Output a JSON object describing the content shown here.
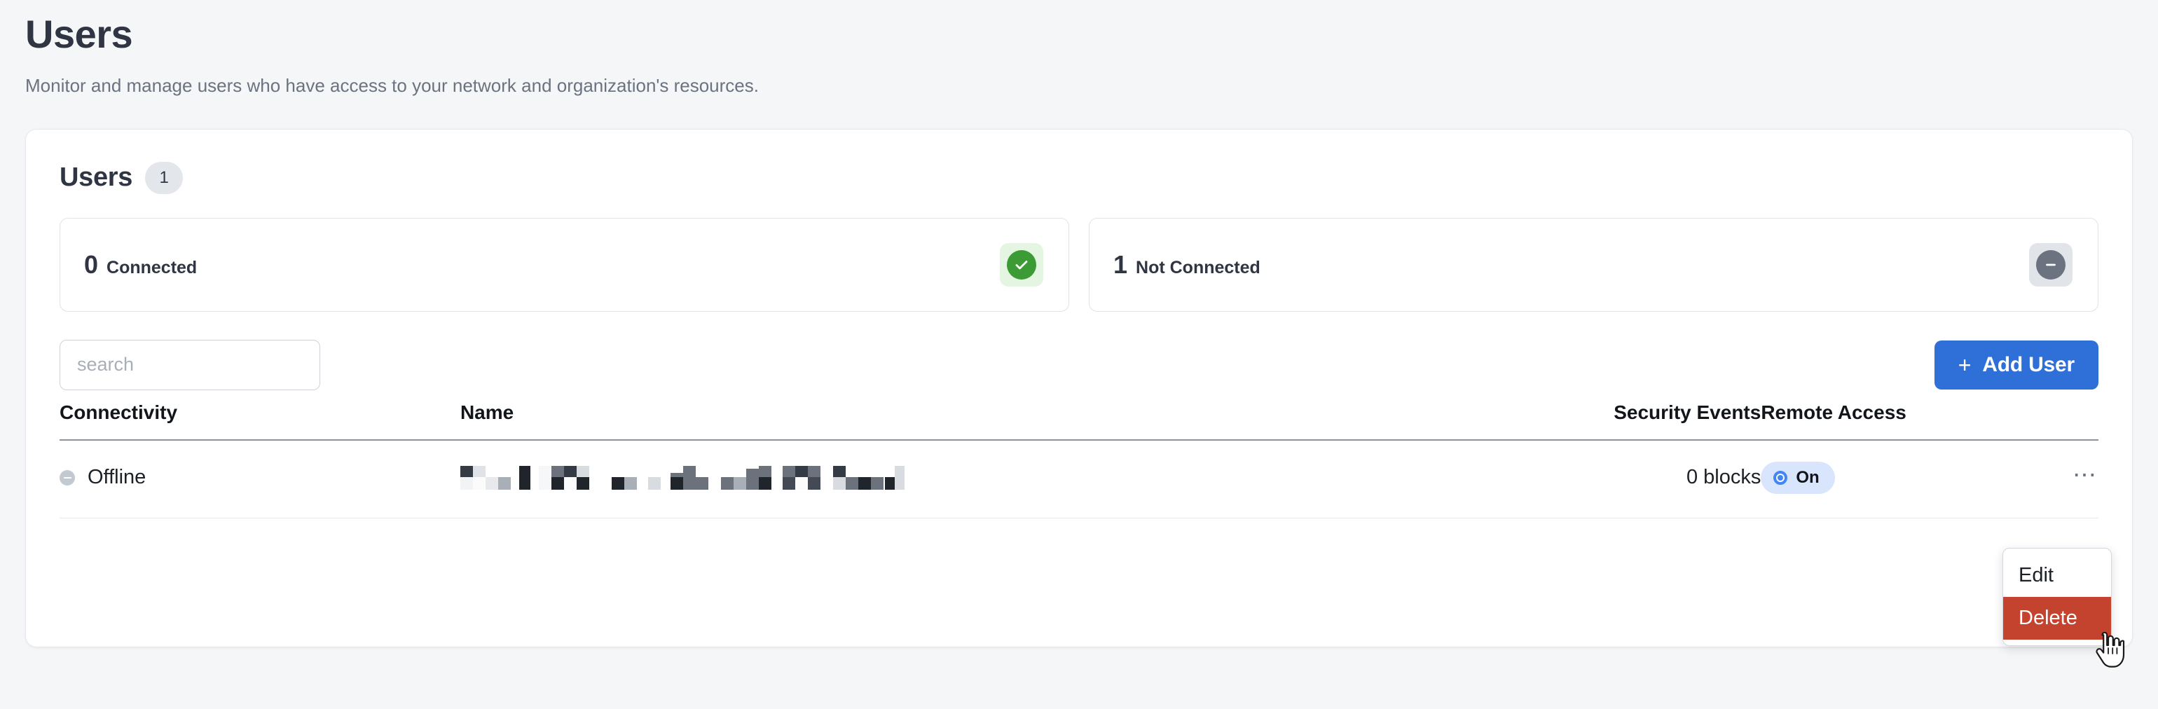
{
  "header": {
    "title": "Users",
    "subtitle": "Monitor and manage users who have access to your network and organization's resources."
  },
  "panel": {
    "title": "Users",
    "count": "1"
  },
  "stats": [
    {
      "value": "0",
      "label": "Connected",
      "icon": "check-circle-icon",
      "icon_color": "#3d9b35",
      "icon_bg": "#e4f5e2"
    },
    {
      "value": "1",
      "label": "Not Connected",
      "icon": "minus-circle-icon",
      "icon_color": "#6b7280",
      "icon_bg": "#e1e5e9"
    }
  ],
  "toolbar": {
    "search_placeholder": "search",
    "search_value": "",
    "add_user_label": "Add User",
    "add_user_plus": "+",
    "accent_color": "#2f6fd8"
  },
  "table": {
    "columns": [
      "Connectivity",
      "Name",
      "Security Events",
      "Remote Access",
      ""
    ],
    "rows": [
      {
        "connectivity": "Offline",
        "name": "",
        "name_redacted": true,
        "security_events": "0 blocks",
        "remote_access": "On",
        "remote_access_color": "#4285f4",
        "actions_icon": "ellipsis-icon"
      }
    ]
  },
  "pagination": {
    "prev_label": "‹"
  },
  "context_menu": {
    "items": [
      {
        "label": "Edit",
        "danger": false
      },
      {
        "label": "Delete",
        "danger": true
      }
    ],
    "danger_color": "#c4432f"
  }
}
